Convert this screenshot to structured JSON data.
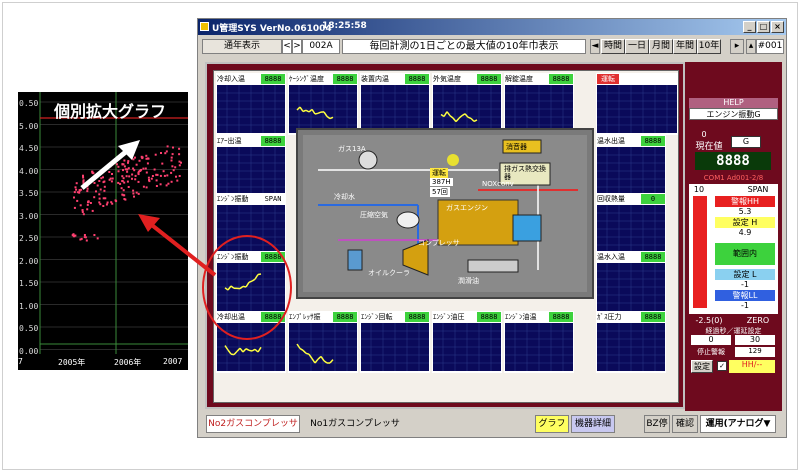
{
  "zoom_graph": {
    "title": "個別拡大グラフ",
    "y_ticks": [
      "0.50",
      "5.00",
      "4.50",
      "4.00",
      "3.50",
      "3.00",
      "2.50",
      "2.00",
      "1.50",
      "1.00",
      "0.50",
      "0.00"
    ],
    "x_ticks": [
      "7",
      "2005年",
      "2006年",
      "2007"
    ]
  },
  "window": {
    "title": "U管理SYS  VerNo.061004",
    "clock": "18:25:58",
    "minimize": "_",
    "maximize": "□",
    "close": "×"
  },
  "toolbar": {
    "mode": "通年表示",
    "code": "002A",
    "description": "毎回計測の1日ごとの最大値の10年巾表示",
    "buttons": [
      "時間",
      "一日",
      "月間",
      "年間",
      "10年"
    ],
    "page": "#001"
  },
  "tiles": [
    {
      "label": "冷却入温",
      "value": "8888"
    },
    {
      "label": "ｹｰｼﾝｸﾞ温度",
      "value": "8888"
    },
    {
      "label": "装置内温",
      "value": "8888"
    },
    {
      "label": "外気温度",
      "value": "8888"
    },
    {
      "label": "解錠温度",
      "value": "8888"
    },
    {
      "label": "運転",
      "value": ""
    },
    {
      "label": "ｴｱｰ出温",
      "value": "8888"
    },
    {
      "label": "温水出温",
      "value": "8888"
    },
    {
      "label": "ｴﾝｼﾞﾝ振動",
      "value": "SPAN"
    },
    {
      "label": "回収熱量",
      "value": "0"
    },
    {
      "label": "ｴﾝｼﾞﾝ振動",
      "value": "8888"
    },
    {
      "label": "温水入温",
      "value": "8888"
    },
    {
      "label": "冷却出温",
      "value": "8888"
    },
    {
      "label": "ｴﾝﾌﾟﾚｯｻ振",
      "value": "8888"
    },
    {
      "label": "ｴﾝｼﾞﾝ回転",
      "value": "8888"
    },
    {
      "label": "ｴﾝｼﾞﾝ油圧",
      "value": "8888"
    },
    {
      "label": "ｴﾝｼﾞﾝ油温",
      "value": "8888"
    },
    {
      "label": "ｶﾞｽ圧力",
      "value": "8888"
    }
  ],
  "diagram": {
    "gas": "ガス13A",
    "cooling_water": "冷却水",
    "compressed_air": "圧縮空気",
    "run": "運転",
    "run_hours": "387H",
    "run_count": "57回",
    "engine": "ガスエンジン",
    "nox": "NOXconv",
    "muffler": "消音器",
    "exhaust_hx": "排ガス熱交換器",
    "compressor": "コンプレッサ",
    "oil_cooler": "オイルクーラ",
    "lube_oil": "潤滑油"
  },
  "side": {
    "help": "HELP",
    "selected": "エンジン振動G",
    "current_label": "現在値",
    "current_prefix": "0",
    "unit": "G",
    "current_value": "8888",
    "com": "COM1 Ad001-2/8",
    "scale_top": "10",
    "span": "SPAN",
    "alarm_hh": "警報HH",
    "hh_value": "5.3",
    "setting_h": "設定 H",
    "h_value": "4.9",
    "in_range": "範囲内",
    "setting_l": "設定 L",
    "l_value": "-1",
    "alarm_ll": "警報LL",
    "ll_value": "-1",
    "zero_min": "-2.5(0)",
    "zero": "ZERO",
    "delay_label": "経過秒／運延設定",
    "delay_a": "0",
    "delay_b": "30",
    "stop_label": "停止警報",
    "stop_value": "129",
    "setting_btn": "設定",
    "hh_check": "HH/--"
  },
  "bottom": {
    "tab_active": "No2ガスコンプレッサ",
    "tab_other": "No1ガスコンプレッサ",
    "graph": "グラフ",
    "detail": "機器詳細",
    "bz_stop": "BZ停",
    "confirm": "確認",
    "mode_select": "運用(アナログ▼"
  },
  "colors": {
    "panel_maroon": "#6e0a1e",
    "graph_bg": "#0a0a5a",
    "value_green": "#3dd23d",
    "trace_yellow": "#ffff40",
    "alarm_red": "#e02020"
  }
}
